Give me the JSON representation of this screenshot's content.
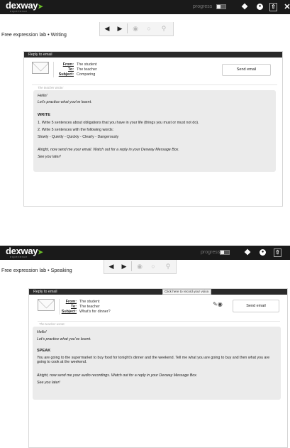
{
  "shots": [
    {
      "app": {
        "logo": "dexway",
        "logo_sub": "experience",
        "progress_label": "progress",
        "progress_value": 0.4
      },
      "breadcrumb": "Free expression lab • Writing",
      "panel_title": "Reply to email",
      "email": {
        "from_label": "From:",
        "from_value": "The student",
        "to_label": "To:",
        "to_value": "The teacher",
        "subject_label": "Subject:",
        "subject_value": "Comparing"
      },
      "send_label": "Send email",
      "msg_header": "The teacher wrote:",
      "message": {
        "greeting": "Hello!",
        "intro": "Let's practice what you've learnt.",
        "task_title": "WRITE",
        "lines": [
          "1. Write 5 sentences about obligations that you have in your life (things you must or must not do).",
          "2. Write 5 sentences with the following words:",
          "Slowly - Quietly - Quickly - Clearly - Dangerously"
        ],
        "closing": "Alright, now send me your email. Watch out for a reply in your Dexway Message Box.",
        "signoff": "See you later!"
      }
    },
    {
      "app": {
        "logo": "dexway",
        "logo_sub": "experience",
        "progress_label": "progress",
        "progress_value": 0.4
      },
      "breadcrumb": "Free expression lab • Speaking",
      "panel_title": "Reply to email",
      "tooltip": "Click here to record your voice.",
      "email": {
        "from_label": "From:",
        "from_value": "The student",
        "to_label": "To:",
        "to_value": "The teacher",
        "subject_label": "Subject:",
        "subject_value": "What's for dinner?"
      },
      "send_label": "Send email",
      "msg_header": "The teacher wrote:",
      "message": {
        "greeting": "Hello!",
        "intro": "Let's practice what you've learnt.",
        "task_title": "SPEAK",
        "lines": [
          "You are going to the supermarket to buy food for tonight's dinner and the weekend. Tell me what you are going to buy and then what you are going to cook at the weekend."
        ],
        "closing": "Alright, now send me your audio recordings. Watch out for a reply in your Dexway Message Box.",
        "signoff": "See you later!"
      }
    }
  ]
}
